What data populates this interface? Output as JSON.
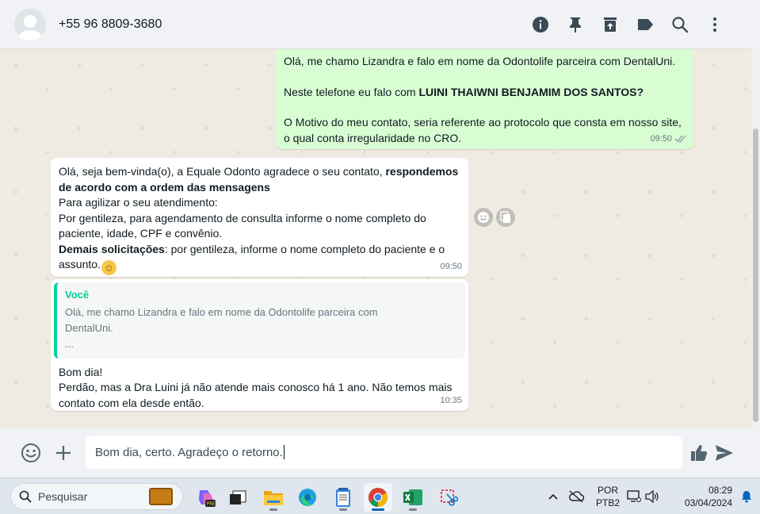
{
  "header": {
    "contact_name": "+55 96 8809-3680",
    "icons": [
      "info-icon",
      "pin-icon",
      "archive-icon",
      "label-icon",
      "search-icon",
      "menu-icon"
    ]
  },
  "messages": {
    "m1": {
      "line1": "Olá, me chamo Lizandra e falo em nome da Odontolife parceira com DentalUni.",
      "line2_prefix": "Neste telefone eu falo com ",
      "line2_bold": "LUINI THAIWNI BENJAMIM DOS SANTOS?",
      "line3a": "O Motivo do meu contato, seria referente ao protocolo que consta em nosso site,",
      "line3b": "o qual conta irregularidade no CRO.",
      "time": "09:50"
    },
    "m2": {
      "line1_prefix": "Olá, seja bem-vinda(o), a Equale Odonto agradece o seu contato, ",
      "line1_bold": "respondemos",
      "line2_bold": "de acordo com a ordem das mensagens",
      "line3": "Para agilizar o seu atendimento:",
      "line4": "Por gentileza, para agendamento de consulta informe o nome completo do",
      "line5": "paciente, idade, CPF e convênio.",
      "line6_bold": "Demais solicitações",
      "line6_rest": ": por gentileza, informe o nome completo do paciente e o",
      "line7": "assunto.",
      "emoji": "☺",
      "time": "09:50"
    },
    "m3": {
      "quote_author": "Você",
      "quote_line1": "Olá, me chamo Lizandra e falo em nome da Odontolife parceira com",
      "quote_line2": "DentalUni.",
      "quote_line3": "...",
      "line1": "Bom dia!",
      "line2": "Perdão, mas a Dra Luini já não atende mais conosco há 1 ano. Não temos mais",
      "line3": "contato com ela desde então.",
      "time": "10:35"
    }
  },
  "composer": {
    "value": "Bom dia, certo. Agradeço o retorno."
  },
  "taskbar": {
    "search_placeholder": "Pesquisar",
    "lang_line1": "POR",
    "lang_line2": "PTB2",
    "clock_time": "08:29",
    "clock_date": "03/04/2024"
  },
  "colors": {
    "outgoing_bubble": "#d9fdd3",
    "incoming_bubble": "#ffffff",
    "quote_accent": "#06cf9c",
    "chat_bg": "#efeae2"
  }
}
